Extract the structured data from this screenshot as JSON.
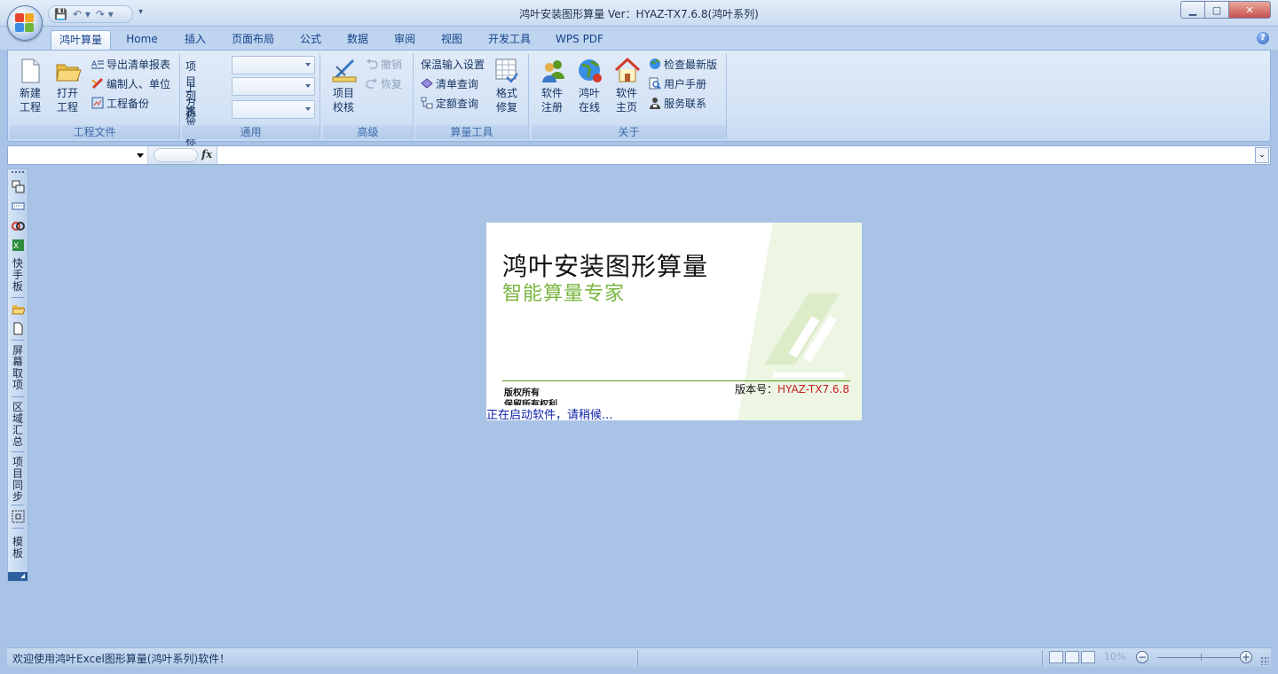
{
  "window": {
    "title": "鸿叶安装图形算量  Ver：HYAZ-TX7.6.8(鸿叶系列)",
    "min_label": "▁",
    "max_label": "▢",
    "close_label": "✕"
  },
  "qat": {
    "save": "💾",
    "undo": "↶ ▾",
    "redo": "↷ ▾",
    "dropdown": "▾"
  },
  "tabs": [
    {
      "label": "鸿叶算量",
      "active": true
    },
    {
      "label": "Home"
    },
    {
      "label": "插入"
    },
    {
      "label": "页面布局"
    },
    {
      "label": "公式"
    },
    {
      "label": "数据"
    },
    {
      "label": "审阅"
    },
    {
      "label": "视图"
    },
    {
      "label": "开发工具"
    },
    {
      "label": "WPS PDF"
    }
  ],
  "help": "?",
  "ribbon": {
    "project_files": {
      "label": "工程文件",
      "new_line1": "新建",
      "new_line2": "工程",
      "open_line1": "打开",
      "open_line2": "工程",
      "export": "导出清单报表",
      "editor": "编制人、单位",
      "backup": "工程备份"
    },
    "general": {
      "label": "通用",
      "project_list": "项目列表",
      "top_label": "上方标注",
      "horizontal_label": "水平标注"
    },
    "advanced": {
      "label": "高级",
      "check_line1": "项目",
      "check_line2": "校核",
      "undo": "撤销",
      "redo": "恢复"
    },
    "tools": {
      "label": "算量工具",
      "insulation": "保温输入设置",
      "list_query": "清单查询",
      "quota_query": "定额查询",
      "format_line1": "格式",
      "format_line2": "修复"
    },
    "about": {
      "label": "关于",
      "register_line1": "软件",
      "register_line2": "注册",
      "online_line1": "鸿叶",
      "online_line2": "在线",
      "home_line1": "软件",
      "home_line2": "主页",
      "check_update": "检查最新版",
      "manual": "用户手册",
      "contact": "服务联系"
    }
  },
  "formula_bar": {
    "fx": "fx",
    "expand": "⌄"
  },
  "left_toolbar": {
    "quick_panel": "快手板",
    "screen_pick": "屏幕取项",
    "region_sum": "区域汇总",
    "sync": "项目同步",
    "template": "模板"
  },
  "splash": {
    "title": "鸿叶安装图形算量",
    "subtitle": "智能算量专家",
    "copyright1": "版权所有",
    "copyright2": "保留所有权利",
    "version_label": "版本号：",
    "version": "HYAZ-TX7.6.8",
    "loading": "正在启动软件，请稍候..."
  },
  "status": {
    "message": "欢迎使用鸿叶Excel图形算量(鸿叶系列)软件！",
    "zoom": "10%",
    "zoom_minus": "−",
    "zoom_plus": "+"
  },
  "colors": {
    "accent": "#15428b",
    "brand_green": "#7ab640",
    "version_red": "#c42121",
    "loading_blue": "#0b1ea8",
    "workspace": "#a9c3e6"
  }
}
